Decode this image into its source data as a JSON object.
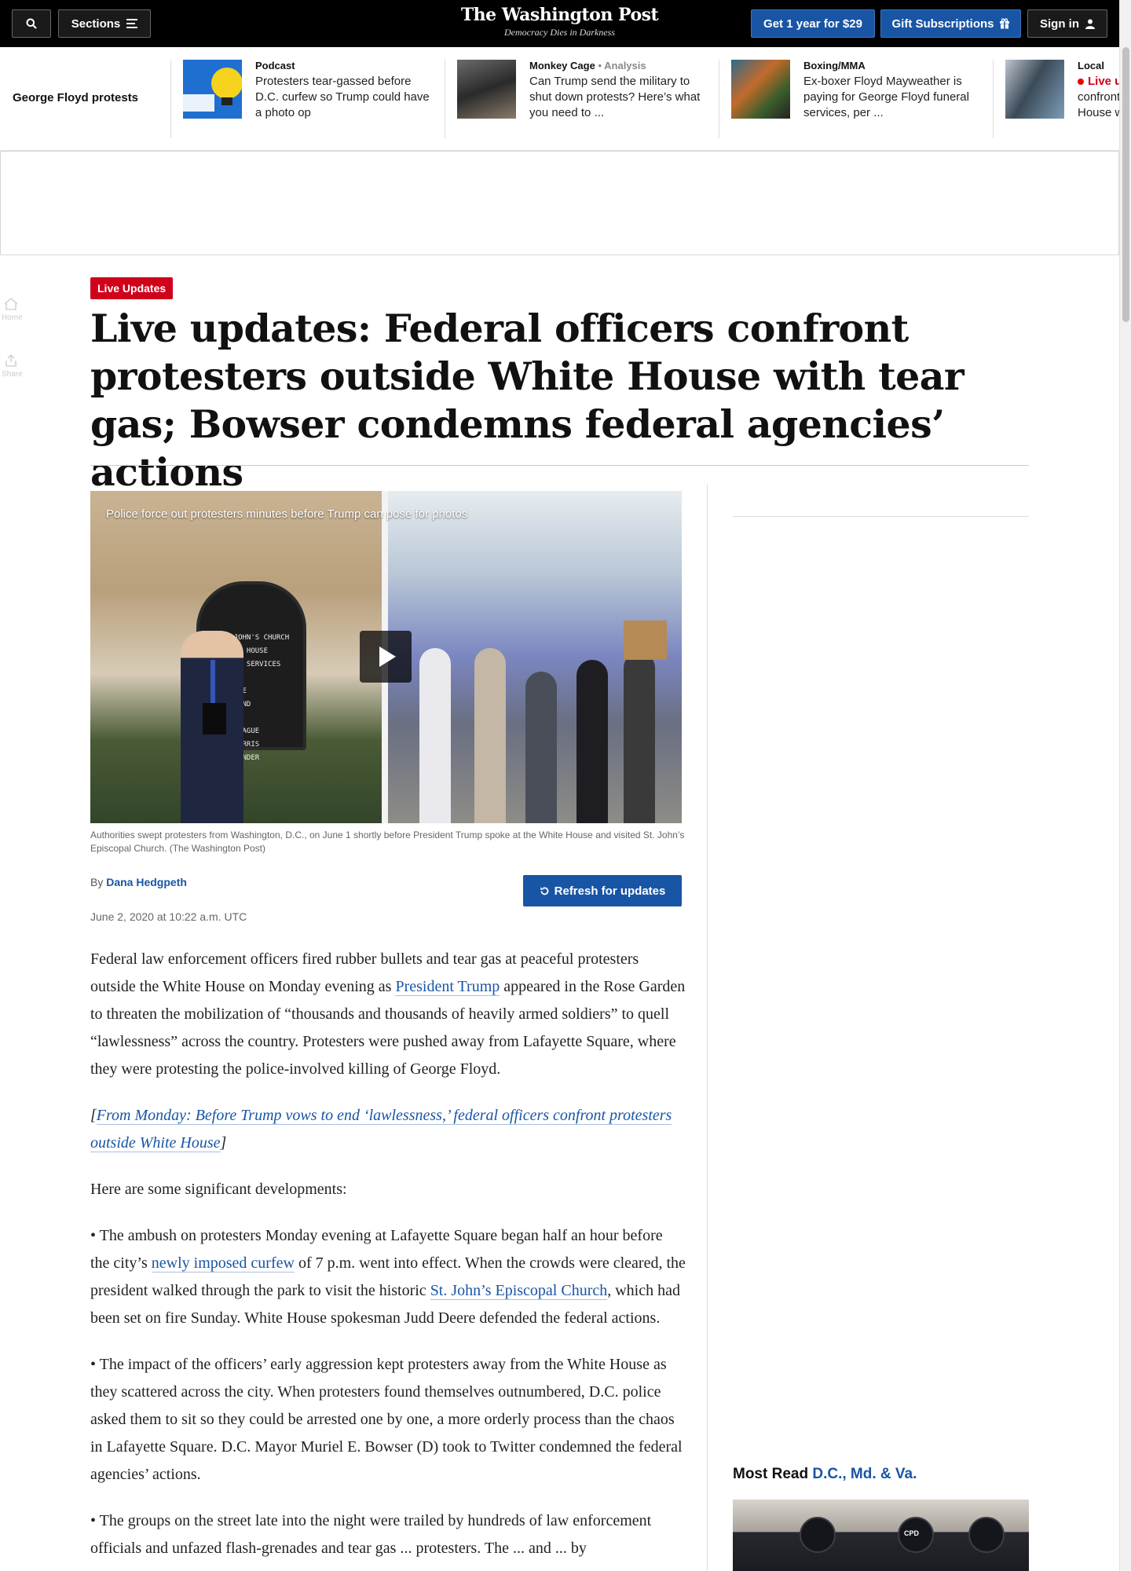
{
  "header": {
    "sections_label": "Sections",
    "logo_name": "The Washington Post",
    "logo_tagline": "Democracy Dies in Darkness",
    "subscribe_label": "Get 1 year for $29",
    "gift_label": "Gift Subscriptions",
    "signin_label": "Sign in"
  },
  "strip": {
    "label": "George Floyd protests",
    "items": [
      {
        "kicker": "Podcast",
        "kicker_extra": "",
        "headline": "Protesters tear-gassed before D.C. curfew so Trump could have a photo op"
      },
      {
        "kicker": "Monkey Cage",
        "kicker_extra": "Analysis",
        "headline": "Can Trump send the military to shut down protests? Here’s what you need to ..."
      },
      {
        "kicker": "Boxing/MMA",
        "kicker_extra": "",
        "headline": "Ex-boxer Floyd Mayweather is paying for George Floyd funeral services, per ..."
      },
      {
        "kicker": "Local",
        "kicker_extra": "",
        "live_label": "Live u",
        "headline": "confront House w"
      }
    ]
  },
  "rail": {
    "home_label": "Home",
    "share_label": "Share"
  },
  "article": {
    "badge": "Live Updates",
    "headline": "Live updates: Federal officers confront protesters outside White House with tear gas; Bowser condemns federal agencies’ actions",
    "video_title": "Police force out protesters minutes before Trump can pose for photos",
    "board_text": [
      "ST. JOHN'S CHURCH",
      "PARISH HOUSE",
      "SUNDAY SERVICES",
      "ONLINE",
      "WELCOME",
      "REVEREND",
      "RECTOR",
      "GLEN HAGUE",
      "JAN MORRIS",
      "NAH PONDER"
    ],
    "caption": "Authorities swept protesters from Washington, D.C., on June 1 shortly before President Trump spoke at the White House and visited St. John’s Episcopal Church. (The Washington Post)",
    "byline_prefix": "By",
    "author": "Dana Hedgpeth",
    "refresh_label": "Refresh for updates",
    "timestamp": "June 2, 2020 at 10:22 a.m. UTC",
    "p1_a": "Federal law enforcement officers fired rubber bullets and tear gas at peaceful protesters outside the White House on Monday evening as ",
    "p1_link": "President Trump",
    "p1_b": " appeared in the Rose Garden to threaten the mobilization of “thousands and thousands of heavily armed soldiers” to quell “lawlessness” across the country. Protesters were pushed away from Lafayette Square, where they were protesting the police-involved killing of George Floyd.",
    "p2_open": "[",
    "p2_link": "From Monday: Before Trump vows to end ‘lawlessness,’ federal officers confront protesters outside White House",
    "p2_close": "]",
    "p3": "Here are some significant developments:",
    "p4_a": "• The ambush on protesters Monday evening at Lafayette Square began half an hour before the city’s ",
    "p4_link1": "newly imposed curfew",
    "p4_b": " of 7 p.m. went into effect. When the crowds were cleared, the president walked through the park to visit the historic ",
    "p4_link2": "St. John’s Episcopal Church",
    "p4_c": ", which had been set on fire Sunday. White House spokesman Judd Deere defended the federal actions.",
    "p5": "• The impact of the officers’ early aggression kept protesters away from the White House as they scattered across the city. When protesters found themselves outnumbered, D.C. police asked them to sit so they could be arrested one by one, a more orderly process than the chaos in Lafayette Square. D.C. Mayor Muriel E. Bowser (D) took to Twitter condemned the federal agencies’ actions.",
    "p6": "• The groups on the street late into the night were trailed by hundreds of law enforcement officials and unfazed flash-grenades and tear gas ... protesters. The ... and ... by"
  },
  "sidebar": {
    "most_read_prefix": "Most Read",
    "most_read_region": "D.C., Md. & Va.",
    "image_badge": "CPD"
  },
  "colors": {
    "accent": "#1955a5",
    "live_red": "#d0021b",
    "topbar": "#000000"
  }
}
